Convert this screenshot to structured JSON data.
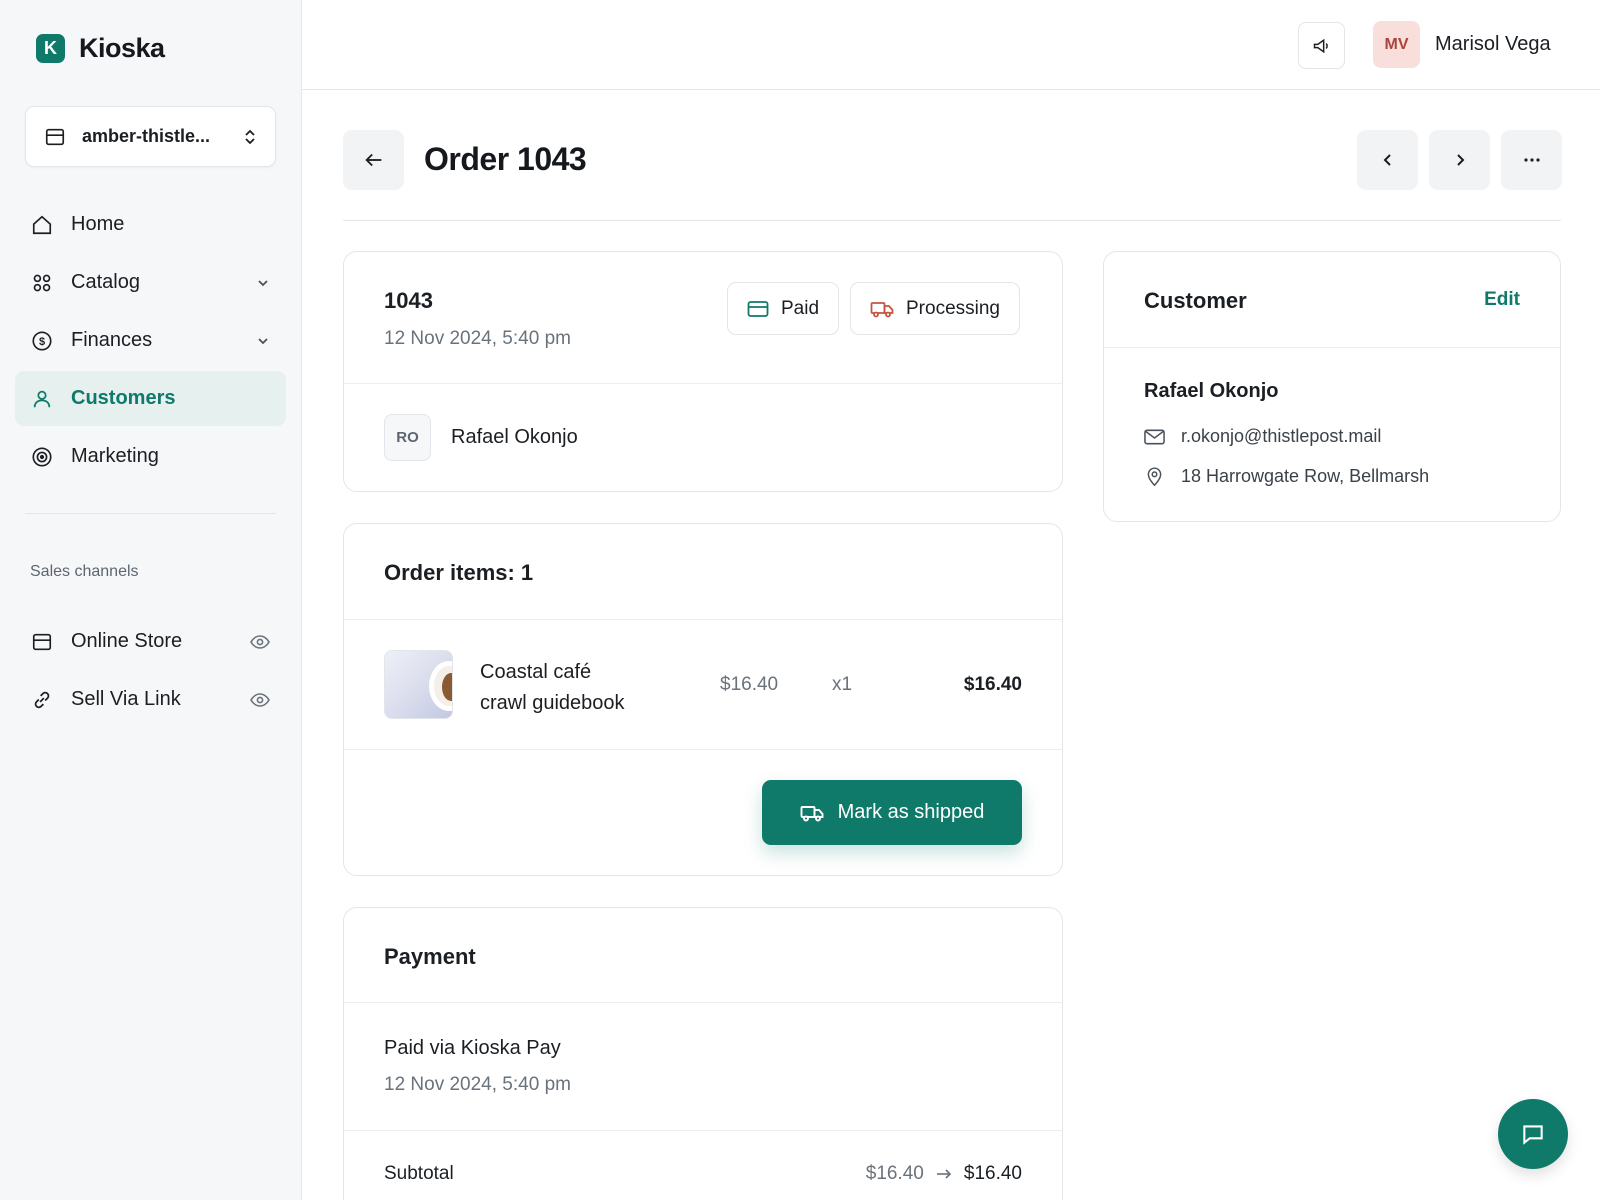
{
  "app": {
    "name": "Kioska",
    "logo_letter": "K"
  },
  "store": {
    "name": "amber-thistle..."
  },
  "nav": {
    "items": [
      {
        "label": "Home",
        "icon": "home-icon"
      },
      {
        "label": "Catalog",
        "icon": "grid-icon",
        "expandable": true
      },
      {
        "label": "Finances",
        "icon": "dollar-circle-icon",
        "expandable": true
      },
      {
        "label": "Customers",
        "icon": "user-icon",
        "active": true
      },
      {
        "label": "Marketing",
        "icon": "target-icon"
      }
    ]
  },
  "sales_channels": {
    "label": "Sales channels",
    "items": [
      {
        "label": "Online Store",
        "icon": "store-icon"
      },
      {
        "label": "Sell Via Link",
        "icon": "link-icon"
      }
    ]
  },
  "topbar": {
    "user_initials": "MV",
    "user_name": "Marisol Vega"
  },
  "page": {
    "title": "Order 1043"
  },
  "order_summary": {
    "number": "1043",
    "date": "12 Nov 2024, 5:40 pm",
    "payment_status": "Paid",
    "fulfillment_status": "Processing",
    "customer_initials": "RO",
    "customer_name": "Rafael Okonjo"
  },
  "order_items": {
    "heading": "Order items: 1",
    "items": [
      {
        "name_line1": "Coastal café",
        "name_line2": "crawl guidebook",
        "price": "$16.40",
        "qty": "x1",
        "total": "$16.40"
      }
    ],
    "action_label": "Mark as shipped"
  },
  "payment": {
    "heading": "Payment",
    "method": "Paid via Kioska Pay",
    "date": "12 Nov 2024, 5:40 pm",
    "subtotal_label": "Subtotal",
    "subtotal_old": "$16.40",
    "subtotal_new": "$16.40"
  },
  "customer": {
    "heading": "Customer",
    "edit_label": "Edit",
    "name": "Rafael Okonjo",
    "email": "r.okonjo@thistlepost.mail",
    "address": "18 Harrowgate Row, Bellmarsh"
  },
  "colors": {
    "accent": "#0f7a6a",
    "accent_soft": "#e6f0ee",
    "avatar_bg": "#f8dfdc",
    "avatar_fg": "#a8463b",
    "shipping_icon": "#c4553f"
  }
}
